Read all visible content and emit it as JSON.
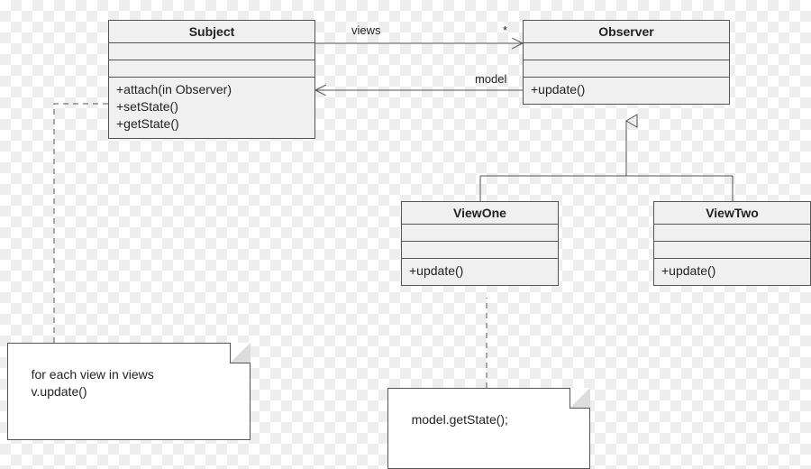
{
  "diagram": {
    "pattern": "Observer",
    "classes": {
      "subject": {
        "name": "Subject",
        "attributes": [],
        "operations": [
          "+attach(in Observer)",
          "+setState()",
          "+getState()"
        ]
      },
      "observer": {
        "name": "Observer",
        "attributes": [],
        "operations": [
          "+update()"
        ]
      },
      "viewOne": {
        "name": "ViewOne",
        "attributes": [],
        "operations": [
          "+update()"
        ]
      },
      "viewTwo": {
        "name": "ViewTwo",
        "attributes": [],
        "operations": [
          "+update()"
        ]
      }
    },
    "associations": {
      "views": {
        "label": "views",
        "multiplicity": "*",
        "from": "Subject",
        "to": "Observer"
      },
      "model": {
        "label": "model",
        "from": "Observer",
        "to": "Subject"
      }
    },
    "notes": {
      "subjectNote": "for each view in views\n    v.update()",
      "viewOneNote": "model.getState();"
    }
  }
}
